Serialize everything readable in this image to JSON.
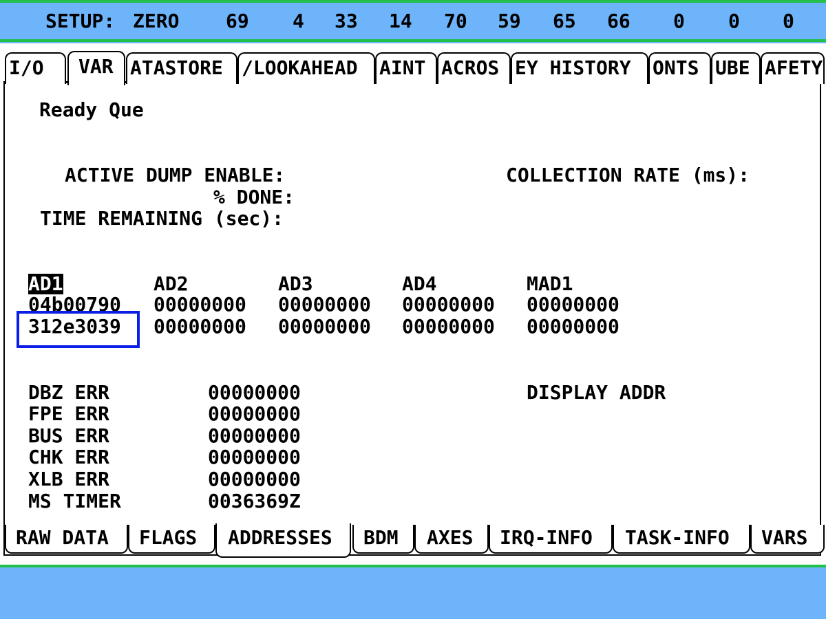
{
  "status_bar": {
    "label": "SETUP:",
    "mode": "ZERO",
    "values": [
      "69",
      "4",
      "33",
      "14",
      "70",
      "59",
      "65",
      "66",
      "0",
      "0",
      "0"
    ]
  },
  "top_tabs": [
    "I/O",
    "VAR",
    "ATASTORE",
    "/LOOKAHEAD",
    "AINT",
    "ACROS",
    "EY HISTORY",
    "ONTS",
    "UBE",
    "AFETY"
  ],
  "active_top_tab": "VAR",
  "main": {
    "ready_queue": "Ready Que",
    "active_dump_enable": "ACTIVE DUMP ENABLE:",
    "percent_done": "% DONE:",
    "time_remaining": "TIME REMAINING (sec):",
    "collection_rate": "COLLECTION RATE (ms):"
  },
  "address_table": {
    "headers": [
      "AD1",
      "AD2",
      "AD3",
      "AD4",
      "MAD1"
    ],
    "rows": [
      [
        "04b00790",
        "00000000",
        "00000000",
        "00000000",
        "00000000"
      ],
      [
        "312e3039",
        "00000000",
        "00000000",
        "00000000",
        "00000000"
      ]
    ]
  },
  "errors": [
    {
      "label": "DBZ ERR",
      "value": "00000000"
    },
    {
      "label": "FPE ERR",
      "value": "00000000"
    },
    {
      "label": "BUS ERR",
      "value": "00000000"
    },
    {
      "label": "CHK ERR",
      "value": "00000000"
    },
    {
      "label": "XLB ERR",
      "value": "00000000"
    },
    {
      "label": "MS TIMER",
      "value": "0036369Z"
    }
  ],
  "display_addr": "DISPLAY ADDR",
  "bottom_tabs": [
    "RAW DATA",
    "FLAGS",
    "ADDRESSES",
    "BDM",
    "AXES",
    "IRQ-INFO",
    "TASK-INFO",
    "VARS"
  ],
  "active_bottom_tab": "ADDRESSES",
  "colors": {
    "background": "#6eb4fa",
    "divider": "#22c04a",
    "highlight_box": "#0a1ee6"
  }
}
